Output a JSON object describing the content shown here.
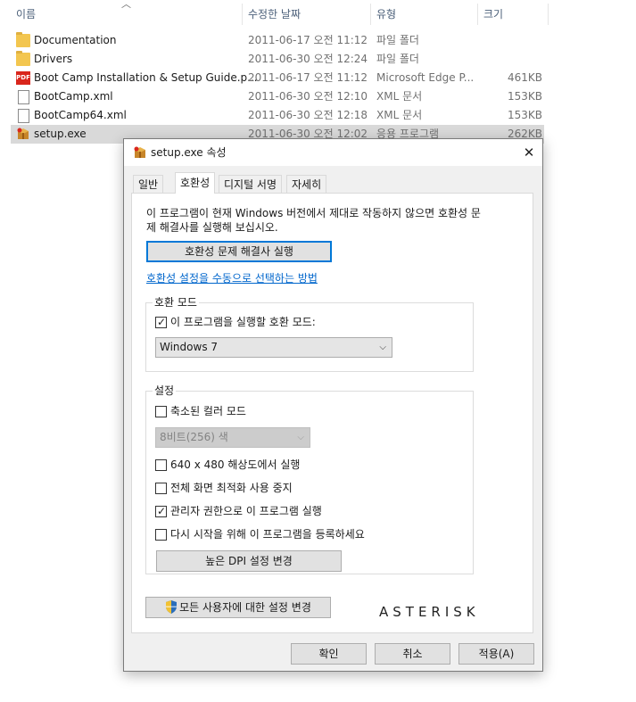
{
  "explorer": {
    "columns": {
      "name": "이름",
      "modified": "수정한 날짜",
      "type": "유형",
      "size": "크기"
    },
    "rows": [
      {
        "name": "Documentation",
        "modified": "2011-06-17 오전 11:12",
        "type": "파일 폴더",
        "size": "",
        "icon": "folder-icon"
      },
      {
        "name": "Drivers",
        "modified": "2011-06-30 오전 12:24",
        "type": "파일 폴더",
        "size": "",
        "icon": "folder-icon"
      },
      {
        "name": "Boot Camp Installation & Setup Guide.p...",
        "modified": "2011-06-17 오전 11:12",
        "type": "Microsoft Edge P...",
        "size": "461KB",
        "icon": "pdf-icon"
      },
      {
        "name": "BootCamp.xml",
        "modified": "2011-06-30 오전 12:10",
        "type": "XML 문서",
        "size": "153KB",
        "icon": "xml-file-icon"
      },
      {
        "name": "BootCamp64.xml",
        "modified": "2011-06-30 오전 12:18",
        "type": "XML 문서",
        "size": "153KB",
        "icon": "xml-file-icon"
      },
      {
        "name": "setup.exe",
        "modified": "2011-06-30 오전 12:02",
        "type": "응용 프로그램",
        "size": "262KB",
        "icon": "setup-icon",
        "selected": true
      }
    ],
    "pdf_icon_text": "PDF"
  },
  "dialog": {
    "title": "setup.exe 속성",
    "close": "✕",
    "tabs": [
      "일반",
      "호환성",
      "디지털 서명",
      "자세히"
    ],
    "active_tab": "호환성",
    "intro": "이 프로그램이 현재 Windows 버전에서 제대로 작동하지 않으면 호환성 문제 해결사를 실행해 보십시오.",
    "troubleshooter_button": "호환성 문제 해결사 실행",
    "manual_link": "호환성 설정을 수동으로 선택하는 방법",
    "compat_mode": {
      "group_label": "호환 모드",
      "checkbox_label": "이 프로그램을 실행할 호환 모드:",
      "checked": true,
      "selected_os": "Windows 7"
    },
    "settings": {
      "group_label": "설정",
      "reduced_color": {
        "label": "축소된 컬러 모드",
        "checked": false
      },
      "color_select": "8비트(256) 색",
      "res_640": {
        "label": "640 x 480 해상도에서 실행",
        "checked": false
      },
      "disable_fullscreen_opt": {
        "label": "전체 화면 최적화 사용 중지",
        "checked": false
      },
      "run_as_admin": {
        "label": "관리자 권한으로 이 프로그램 실행",
        "checked": true
      },
      "register_restart": {
        "label": "다시 시작을 위해 이 프로그램을 등록하세요",
        "checked": false
      },
      "dpi_button": "높은 DPI 설정 변경"
    },
    "all_users_button": "모든 사용자에 대한 설정 변경",
    "watermark": "ASTERISK",
    "ok": "확인",
    "cancel": "취소",
    "apply": "적용(A)",
    "check_mark": "✓",
    "dropdown_arrow": "⌵",
    "accent_color": "#0078d7",
    "link_color": "#0066cc"
  }
}
